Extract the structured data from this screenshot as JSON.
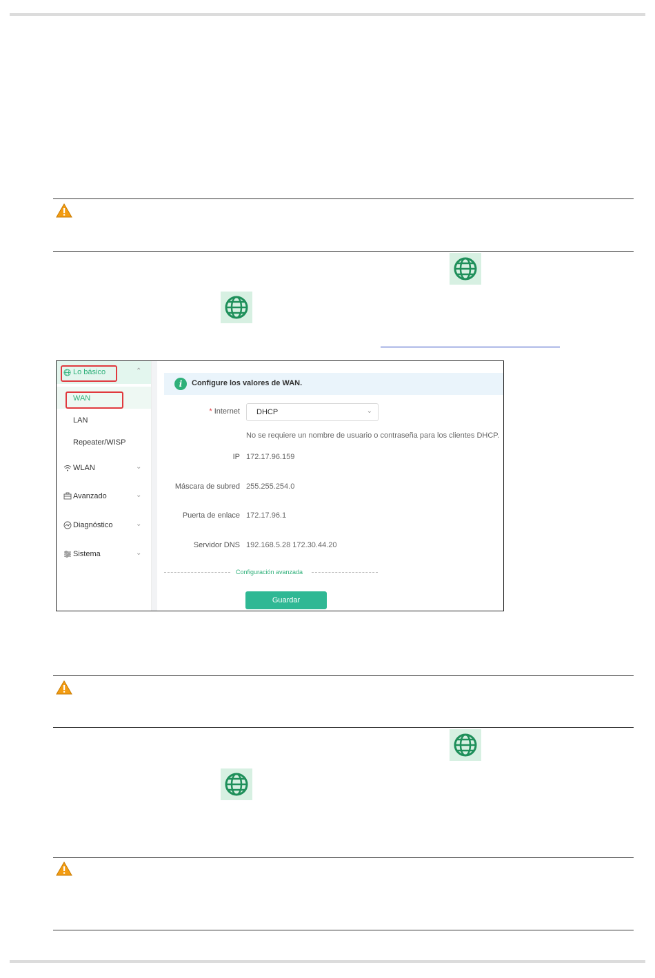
{
  "router_ui": {
    "menu": {
      "basic": "Lo básico",
      "wan": "WAN",
      "lan": "LAN",
      "repeater": "Repeater/WISP",
      "wlan": "WLAN",
      "advanced": "Avanzado",
      "diagnostic": "Diagnóstico",
      "system": "Sistema"
    },
    "banner": "Configure los valores de WAN.",
    "form": {
      "internet_label": "Internet",
      "internet_value": "DHCP",
      "dhcp_note": "No se requiere un nombre de usuario o contraseña para los clientes DHCP.",
      "ip_label": "IP",
      "ip_value": "172.17.96.159",
      "mask_label": "Máscara de subred",
      "mask_value": "255.255.254.0",
      "gateway_label": "Puerta de enlace",
      "gateway_value": "172.17.96.1",
      "dns_label": "Servidor DNS",
      "dns_value": "192.168.5.28 172.30.44.20"
    },
    "advanced_link": "Configuración avanzada",
    "save_button": "Guardar"
  },
  "colors": {
    "accent": "#2fb894",
    "highlight_box": "#e0393e",
    "warning": "#f39c12"
  },
  "icons": [
    "warning-icon",
    "globe-icon",
    "info-icon",
    "wifi-icon",
    "toolbox-icon",
    "diagnostic-icon",
    "settings-sliders-icon",
    "chevron-down-icon",
    "chevron-up-icon"
  ]
}
